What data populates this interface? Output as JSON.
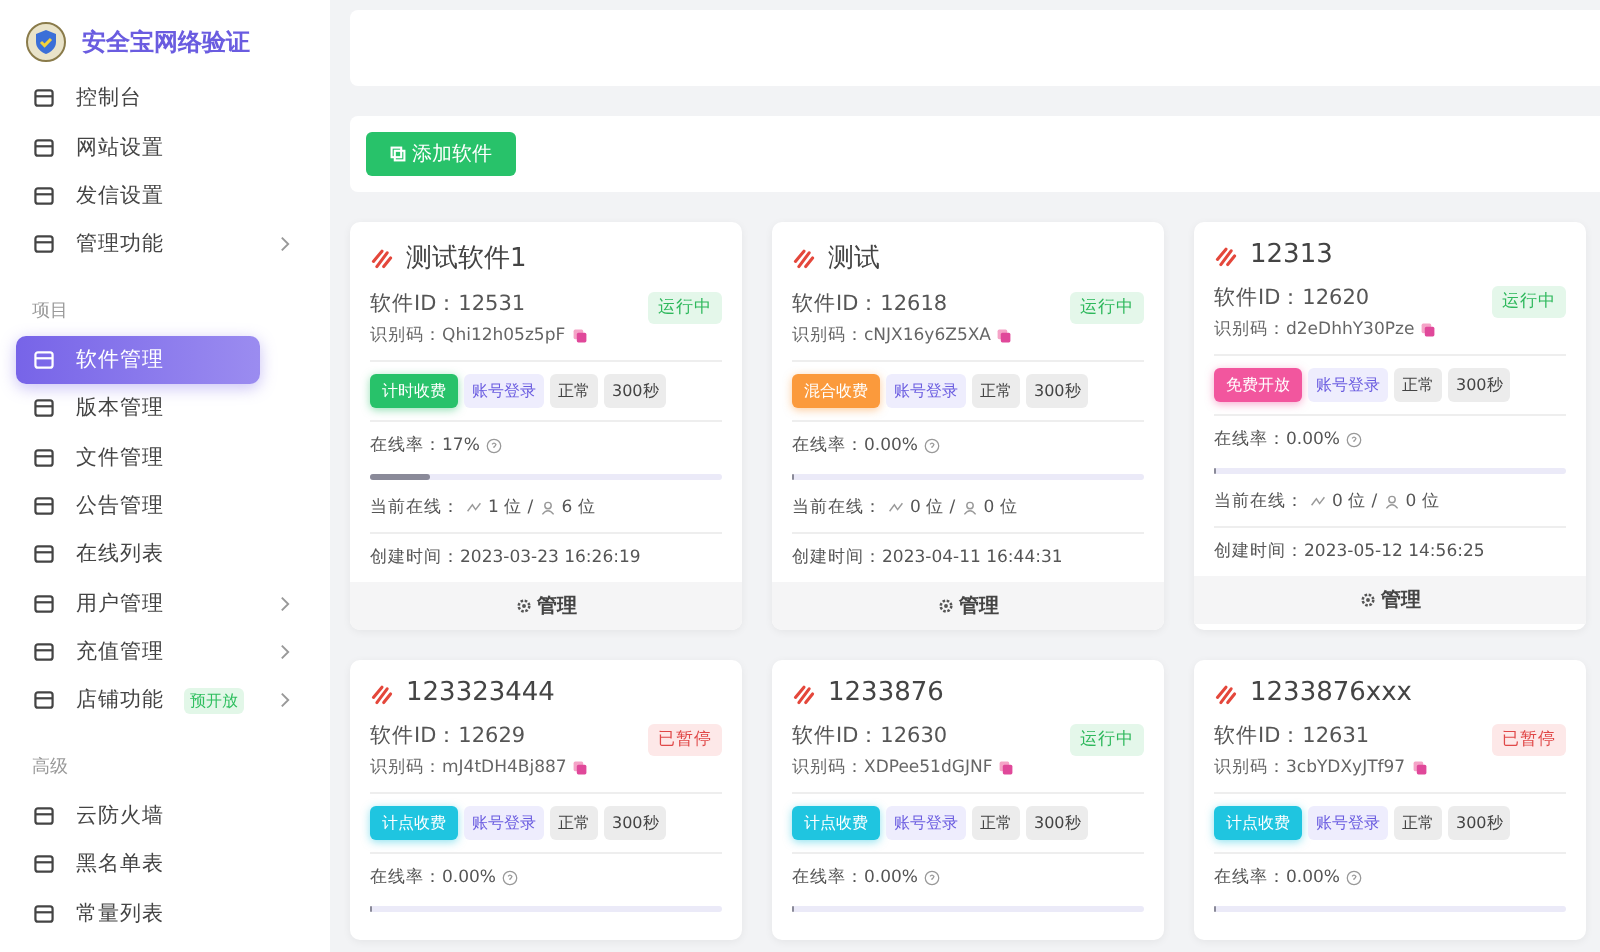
{
  "brand": {
    "title": "安全宝网络验证"
  },
  "sidebar": {
    "groups": [
      {
        "items": [
          {
            "label": "控制台",
            "selected": false,
            "has_arrow": false
          },
          {
            "label": "网站设置",
            "selected": false,
            "has_arrow": false
          },
          {
            "label": "发信设置",
            "selected": false,
            "has_arrow": false
          },
          {
            "label": "管理功能",
            "selected": false,
            "has_arrow": true
          }
        ]
      },
      {
        "heading": "项目",
        "items": [
          {
            "label": "软件管理",
            "selected": true,
            "has_arrow": false
          },
          {
            "label": "版本管理",
            "selected": false,
            "has_arrow": false
          },
          {
            "label": "文件管理",
            "selected": false,
            "has_arrow": false
          },
          {
            "label": "公告管理",
            "selected": false,
            "has_arrow": false
          },
          {
            "label": "在线列表",
            "selected": false,
            "has_arrow": false
          },
          {
            "label": "用户管理",
            "selected": false,
            "has_arrow": true
          },
          {
            "label": "充值管理",
            "selected": false,
            "has_arrow": true
          },
          {
            "label": "店铺功能",
            "selected": false,
            "has_arrow": true,
            "badge": "预开放"
          }
        ]
      },
      {
        "heading": "高级",
        "items": [
          {
            "label": "云防火墙",
            "selected": false,
            "has_arrow": false
          },
          {
            "label": "黑名单表",
            "selected": false,
            "has_arrow": false
          },
          {
            "label": "常量列表",
            "selected": false,
            "has_arrow": false
          }
        ]
      }
    ]
  },
  "toolbar": {
    "add_button": "添加软件"
  },
  "cards": [
    {
      "name": "测试软件1",
      "id": "软件ID：12531",
      "code": "识别码：Qhi12h05z5pF",
      "status": {
        "kind": "running",
        "label": "运行中"
      },
      "charge": {
        "kind": "timed",
        "label": "计时收费"
      },
      "login": "账号登录",
      "state": "正常",
      "interval": "300秒",
      "rate": "在线率：17%",
      "level": 0.17,
      "online": [
        "当前在线：",
        "1 位 /",
        "6 位"
      ],
      "created": "创建时间：2023-03-23 16:26:19",
      "manage": "管理"
    },
    {
      "name": "测试",
      "id": "软件ID：12618",
      "code": "识别码：cNJX16y6Z5XA",
      "status": {
        "kind": "running",
        "label": "运行中"
      },
      "charge": {
        "kind": "mixed",
        "label": "混合收费"
      },
      "login": "账号登录",
      "state": "正常",
      "interval": "300秒",
      "rate": "在线率：0.00%",
      "level": 0,
      "online": [
        "当前在线：",
        "0 位 /",
        "0 位"
      ],
      "created": "创建时间：2023-04-11 16:44:31",
      "manage": "管理"
    },
    {
      "name": "12313",
      "id": "软件ID：12620",
      "code": "识别码：d2eDhhY30Pze",
      "status": {
        "kind": "running",
        "label": "运行中"
      },
      "charge": {
        "kind": "free",
        "label": "免费开放"
      },
      "login": "账号登录",
      "state": "正常",
      "interval": "300秒",
      "rate": "在线率：0.00%",
      "level": 0,
      "online": [
        "当前在线：",
        "0 位 /",
        "0 位"
      ],
      "created": "创建时间：2023-05-12 14:56:25",
      "manage": "管理"
    },
    {
      "name": "123323444",
      "id": "软件ID：12629",
      "code": "识别码：mJ4tDH4Bj887",
      "status": {
        "kind": "paused",
        "label": "已暂停"
      },
      "charge": {
        "kind": "points",
        "label": "计点收费"
      },
      "login": "账号登录",
      "state": "正常",
      "interval": "300秒",
      "rate": "在线率：0.00%",
      "level": 0
    },
    {
      "name": "1233876",
      "id": "软件ID：12630",
      "code": "识别码：XDPee51dGJNF",
      "status": {
        "kind": "running",
        "label": "运行中"
      },
      "charge": {
        "kind": "points",
        "label": "计点收费"
      },
      "login": "账号登录",
      "state": "正常",
      "interval": "300秒",
      "rate": "在线率：0.00%",
      "level": 0
    },
    {
      "name": "1233876xxx",
      "id": "软件ID：12631",
      "code": "识别码：3cbYDXyJTf97",
      "status": {
        "kind": "paused",
        "label": "已暂停"
      },
      "charge": {
        "kind": "points",
        "label": "计点收费"
      },
      "login": "账号登录",
      "state": "正常",
      "interval": "300秒",
      "rate": "在线率：0.00%",
      "level": 0
    }
  ]
}
